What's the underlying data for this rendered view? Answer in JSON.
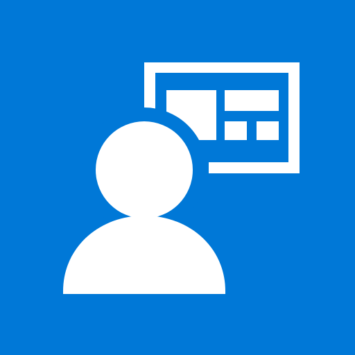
{
  "tile": {
    "background_color": "#0078d7",
    "glyph_color": "#ffffff",
    "icon": "person-with-dashboard-screen-icon"
  }
}
